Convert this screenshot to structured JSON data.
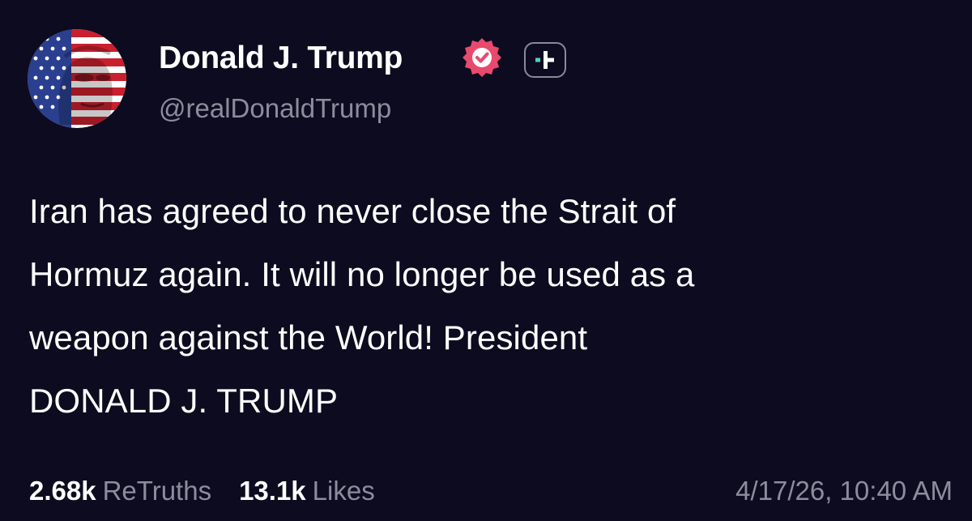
{
  "author": {
    "display_name": "Donald J. Trump",
    "handle": "@realDonaldTrump",
    "verified_icon": "verified-badge-icon",
    "plus_icon": "plus-badge-icon"
  },
  "post": {
    "lines": [
      "Iran has agreed to never close the Strait of",
      "Hormuz again. It will no longer be used as a",
      "weapon against the World! President",
      "DONALD J. TRUMP"
    ]
  },
  "stats": {
    "retruths_count": "2.68k",
    "retruths_label": "ReTruths",
    "likes_count": "13.1k",
    "likes_label": "Likes"
  },
  "timestamp": "4/17/26, 10:40 AM",
  "colors": {
    "background": "#0d0b1f",
    "text_primary": "#ffffff",
    "text_secondary": "#8e8c9c",
    "verified_badge": "#e84a6e",
    "plus_accent": "#4fd1c5"
  }
}
